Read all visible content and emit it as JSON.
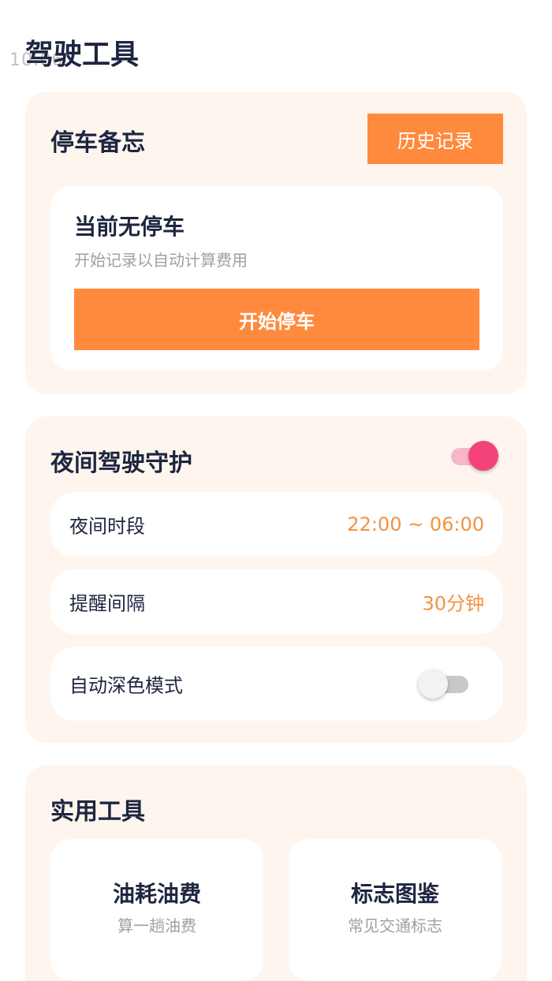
{
  "status_bar": {
    "text": "10:06"
  },
  "header": {
    "title": "驾驶工具"
  },
  "parking": {
    "title": "停车备忘",
    "history_label": "历史记录",
    "status_title": "当前无停车",
    "status_subtitle": "开始记录以自动计算费用",
    "start_label": "开始停车"
  },
  "night_guard": {
    "title": "夜间驾驶守护",
    "enabled": true,
    "rows": [
      {
        "label": "夜间时段",
        "value": "22:00 ~ 06:00"
      },
      {
        "label": "提醒间隔",
        "value": "30分钟"
      },
      {
        "label": "自动深色模式",
        "toggle": false
      }
    ]
  },
  "tools": {
    "title": "实用工具",
    "items": [
      {
        "title": "油耗油费",
        "subtitle": "算一趟油费"
      },
      {
        "title": "标志图鉴",
        "subtitle": "常见交通标志"
      }
    ]
  },
  "colors": {
    "accent": "#ff8a3d",
    "card_bg": "#fdf5ee",
    "toggle_on": "#f4437b",
    "value_text": "#f39241"
  }
}
